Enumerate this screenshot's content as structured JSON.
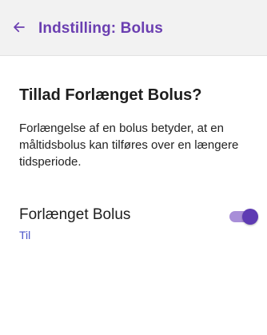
{
  "header": {
    "back_icon": "arrow-left-icon",
    "title": "Indstilling: Bolus"
  },
  "main": {
    "section_title": "Tillad Forlænget Bolus?",
    "description": "Forlængelse af en bolus betyder, at en måltidsbolus kan tilføres over en længere tidsperiode.",
    "setting": {
      "label": "Forlænget Bolus",
      "value": "Til",
      "toggle_on": true
    }
  },
  "colors": {
    "accent": "#6b3fb1",
    "value_text": "#4a55c9",
    "toggle_track": "#a88ed8",
    "toggle_thumb": "#5e3bb3",
    "app_bar_bg": "#f2f2f2"
  }
}
